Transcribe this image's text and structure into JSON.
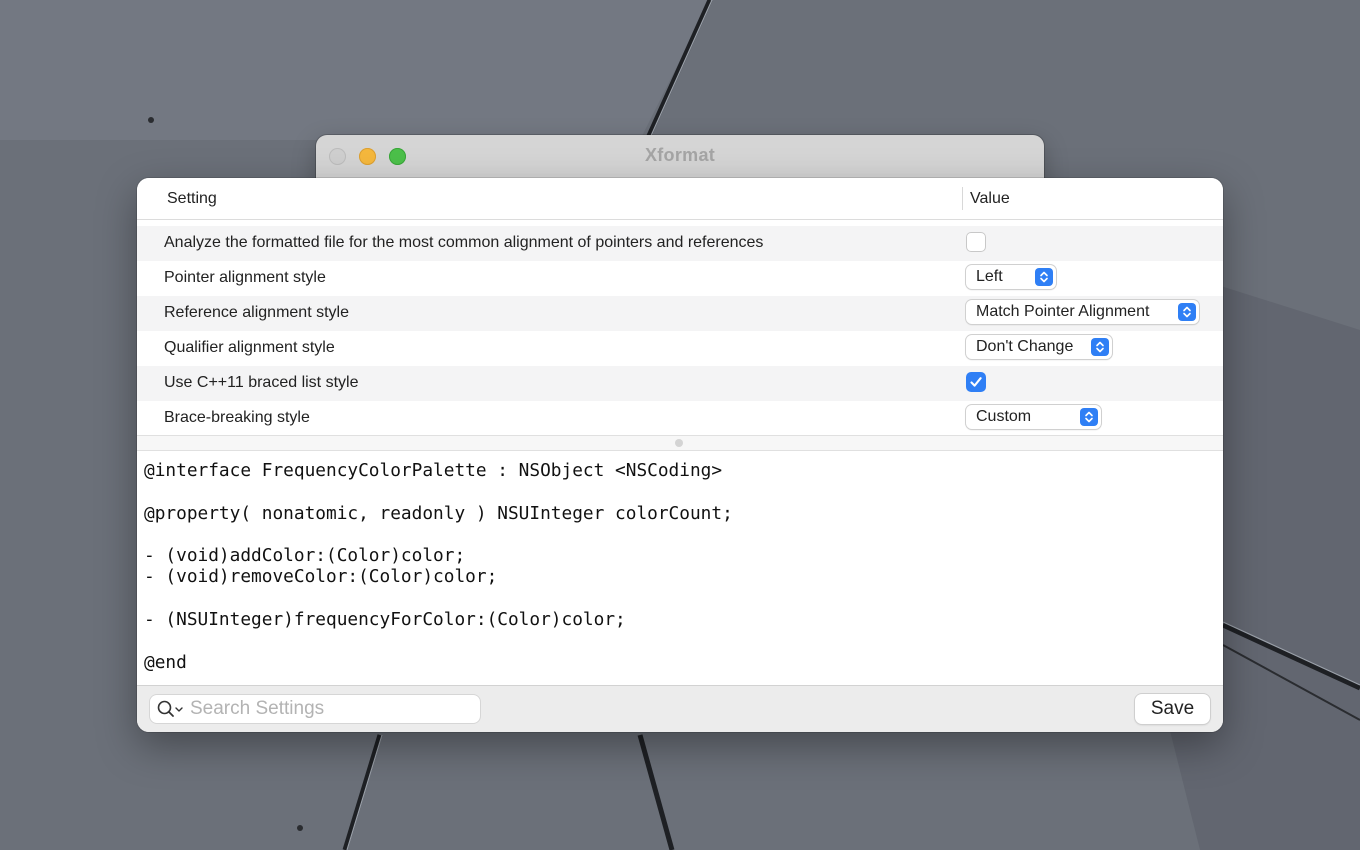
{
  "window": {
    "title": "Xformat"
  },
  "table": {
    "columns": {
      "setting": "Setting",
      "value": "Value"
    },
    "rows": [
      {
        "label": "Analyze the formatted file for the most common alignment of pointers and references",
        "control": "checkbox",
        "checked": false
      },
      {
        "label": "Pointer alignment style",
        "control": "popup",
        "value": "Left"
      },
      {
        "label": "Reference alignment style",
        "control": "popup",
        "value": "Match Pointer Alignment"
      },
      {
        "label": "Qualifier alignment style",
        "control": "popup",
        "value": "Don't Change"
      },
      {
        "label": "Use C++11 braced list style",
        "control": "checkbox",
        "checked": true
      },
      {
        "label": "Brace-breaking style",
        "control": "popup",
        "value": "Custom"
      }
    ]
  },
  "preview": {
    "code": "@interface FrequencyColorPalette : NSObject <NSCoding>\n\n@property( nonatomic, readonly ) NSUInteger colorCount;\n\n- (void)addColor:(Color)color;\n- (void)removeColor:(Color)color;\n\n- (NSUInteger)frequencyForColor:(Color)color;\n\n@end"
  },
  "footer": {
    "search_placeholder": "Search Settings",
    "save_label": "Save"
  },
  "colors": {
    "accent": "#2f7ff5",
    "desktop": "#6b7079"
  }
}
